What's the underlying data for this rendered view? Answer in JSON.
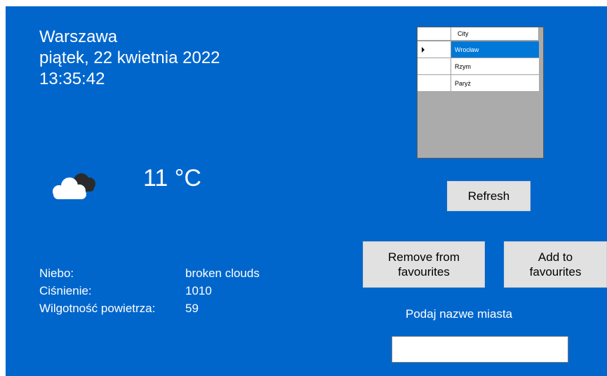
{
  "header": {
    "city": "Warszawa",
    "date": "piątek, 22 kwietnia 2022",
    "time": "13:35:42"
  },
  "weather": {
    "icon": "broken-clouds-icon",
    "temperature": "11 °C"
  },
  "details": [
    {
      "label": "Niebo:",
      "value": "broken clouds"
    },
    {
      "label": "Ciśnienie:",
      "value": "1010"
    },
    {
      "label": "Wilgotność powietrza:",
      "value": "59"
    }
  ],
  "favourites_grid": {
    "column_header": "City",
    "rows": [
      "Wrocław",
      "Rzym",
      "Paryż"
    ],
    "selected_index": 0
  },
  "buttons": {
    "refresh": "Refresh",
    "remove": "Remove from\nfavourites",
    "add": "Add to\nfavourites"
  },
  "search": {
    "prompt": "Podaj nazwe miasta",
    "value": ""
  },
  "colors": {
    "background": "#0066cc",
    "selection": "#0078d7",
    "button": "#e1e1e1",
    "grid_empty": "#ababab"
  }
}
